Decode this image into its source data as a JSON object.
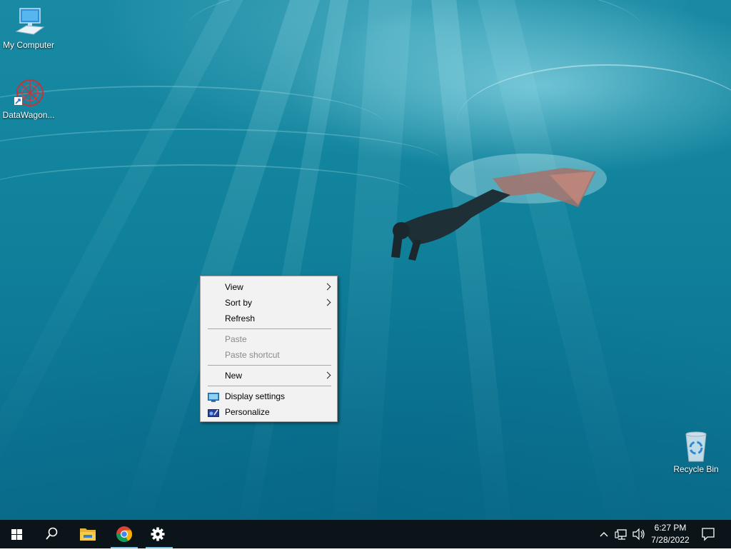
{
  "desktop": {
    "icons": [
      {
        "label": "My Computer",
        "icon": "monitor-icon"
      },
      {
        "label": "DataWagon...",
        "icon": "datawagon-shortcut-icon"
      },
      {
        "label": "Recycle Bin",
        "icon": "recycle-bin-icon"
      }
    ]
  },
  "context_menu": {
    "items": [
      {
        "label": "View",
        "has_submenu": true,
        "enabled": true
      },
      {
        "label": "Sort by",
        "has_submenu": true,
        "enabled": true
      },
      {
        "label": "Refresh",
        "enabled": true
      },
      {
        "label": "Paste",
        "enabled": false
      },
      {
        "label": "Paste shortcut",
        "enabled": false
      },
      {
        "label": "New",
        "has_submenu": true,
        "enabled": true
      },
      {
        "label": "Display settings",
        "icon": "display-settings-icon",
        "enabled": true
      },
      {
        "label": "Personalize",
        "icon": "personalize-icon",
        "enabled": true
      }
    ]
  },
  "taskbar": {
    "buttons": [
      {
        "name": "start",
        "icon": "windows-logo-icon"
      },
      {
        "name": "search",
        "icon": "search-icon"
      },
      {
        "name": "file-explorer",
        "icon": "folder-icon"
      },
      {
        "name": "chrome",
        "icon": "chrome-icon"
      },
      {
        "name": "settings",
        "icon": "gear-icon"
      }
    ],
    "tray": {
      "icons": [
        "chevron-up-icon",
        "network-icon",
        "volume-icon"
      ],
      "time": "6:27 PM",
      "date": "7/28/2022",
      "notification_icon": "notification-icon"
    }
  },
  "colors": {
    "taskbar_bg": "#0b1418",
    "menu_bg": "#f2f2f2",
    "active_indicator": "#7cc4e6"
  }
}
